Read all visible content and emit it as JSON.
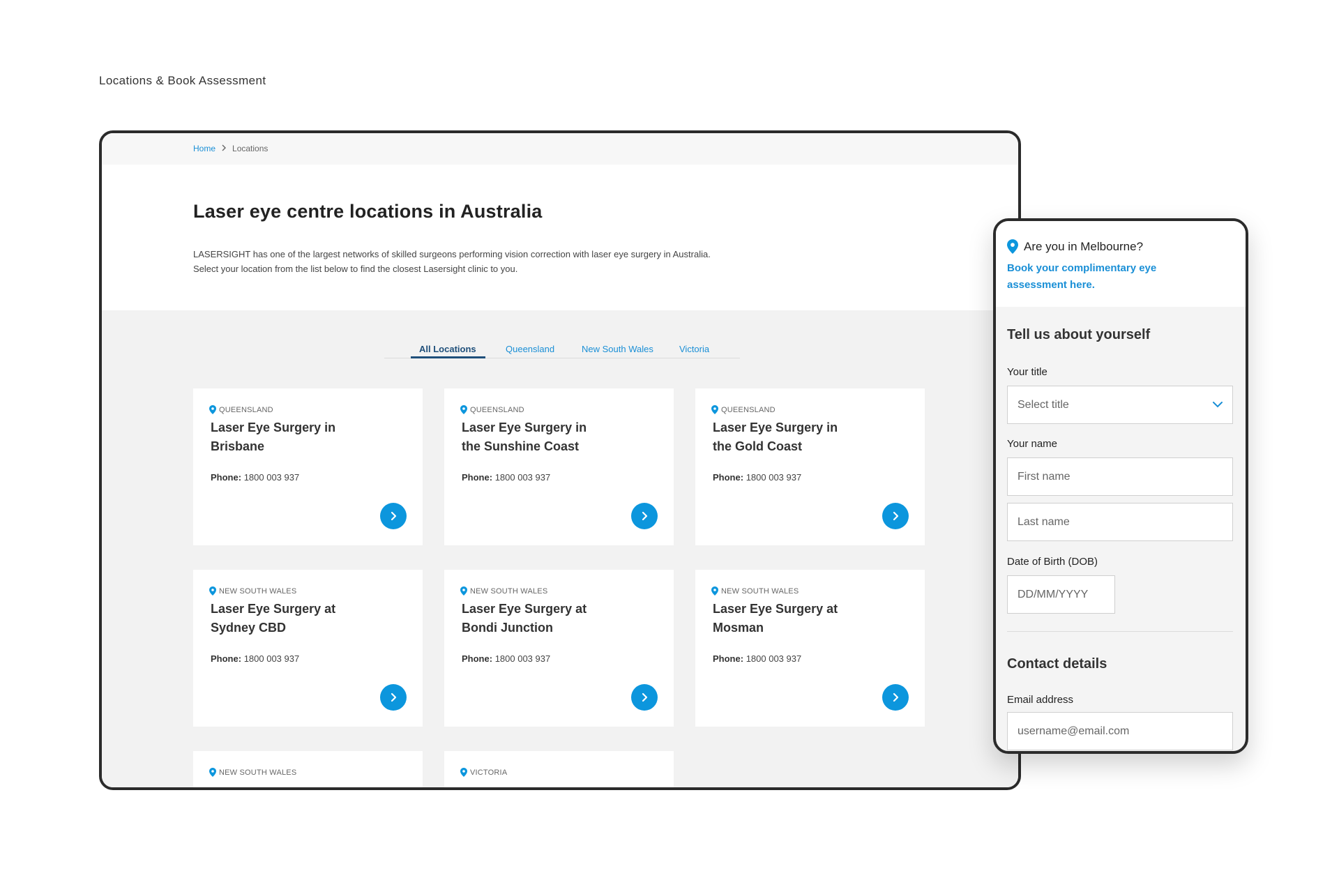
{
  "caption": "Locations & Book Assessment",
  "breadcrumb": {
    "home": "Home",
    "current": "Locations"
  },
  "page": {
    "title": "Laser eye centre locations in Australia",
    "intro": "LASERSIGHT has one of the largest networks of skilled surgeons performing vision correction with laser eye surgery in Australia. Select your location from the list below to find the closest Lasersight clinic to you."
  },
  "tabs": [
    {
      "label": "All Locations",
      "active": true
    },
    {
      "label": "Queensland",
      "active": false
    },
    {
      "label": "New South Wales",
      "active": false
    },
    {
      "label": "Victoria",
      "active": false
    }
  ],
  "phone_label": "Phone:",
  "cards": [
    {
      "region": "QUEENSLAND",
      "title": "Laser Eye Surgery in Brisbane",
      "phone": "1800 003 937"
    },
    {
      "region": "QUEENSLAND",
      "title": "Laser Eye Surgery in the Sunshine Coast",
      "phone": "1800 003 937"
    },
    {
      "region": "QUEENSLAND",
      "title": "Laser Eye Surgery in the Gold Coast",
      "phone": "1800 003 937"
    },
    {
      "region": "NEW SOUTH WALES",
      "title": "Laser Eye Surgery at Sydney CBD",
      "phone": "1800 003 937"
    },
    {
      "region": "NEW SOUTH WALES",
      "title": "Laser Eye Surgery at Bondi Junction",
      "phone": "1800 003 937"
    },
    {
      "region": "NEW SOUTH WALES",
      "title": "Laser Eye Surgery at Mosman",
      "phone": "1800 003 937"
    },
    {
      "region": "NEW SOUTH WALES",
      "title": "",
      "phone": ""
    },
    {
      "region": "VICTORIA",
      "title": "",
      "phone": ""
    }
  ],
  "mobile": {
    "question": "Are you in Melbourne?",
    "book_link": "Book your complimentary eye assessment here.",
    "section1_title": "Tell us about yourself",
    "title_label": "Your title",
    "title_select": "Select title",
    "name_label": "Your name",
    "first_name_placeholder": "First name",
    "last_name_placeholder": "Last name",
    "dob_label": "Date of Birth (DOB)",
    "dob_placeholder": "DD/MM/YYYY",
    "section2_title": "Contact details",
    "email_label": "Email address",
    "email_placeholder": "username@email.com"
  },
  "colors": {
    "accent": "#0c96dd",
    "link": "#1a8fd6",
    "active_tab": "#1f4f7a",
    "frame": "#2b2b2b"
  },
  "icons": {
    "pin": "map-pin-icon",
    "arrow": "chevron-right-icon",
    "dropdown": "chevron-down-icon"
  }
}
